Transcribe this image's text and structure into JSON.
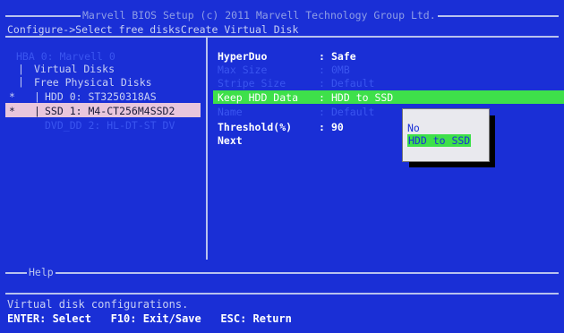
{
  "header": {
    "title": "Marvell BIOS Setup (c) 2011 Marvell Technology Group Ltd.",
    "breadcrumb": "Configure->Select free disksCreate Virtual Disk"
  },
  "tree": {
    "root": "HBA 0: Marvell 0",
    "virtual_disks": "Virtual Disks",
    "free_physical_disks": "Free Physical Disks",
    "disks": [
      {
        "marker": "*",
        "label": "HDD 0: ST3250318AS"
      },
      {
        "marker": "*",
        "label": "SSD 1: M4-CT256M4SSD2"
      },
      {
        "marker": "",
        "label": "DVD_DD 2: HL-DT-ST DV"
      }
    ]
  },
  "settings": [
    {
      "label": "HyperDuo",
      "sep": ":",
      "value": "Safe"
    },
    {
      "label": "Max Size",
      "sep": ":",
      "value": "0MB"
    },
    {
      "label": "Stripe Size",
      "sep": ":",
      "value": "Default"
    },
    {
      "label": "Keep HDD Data",
      "sep": ":",
      "value": "HDD to SSD"
    },
    {
      "label": "Name",
      "sep": ":",
      "value": "Default"
    },
    {
      "label": "Threshold(%)",
      "sep": ":",
      "value": "90"
    }
  ],
  "next_label": "Next",
  "popup": {
    "options": [
      "No",
      "HDD to SSD"
    ],
    "selected": "HDD to SSD"
  },
  "help": {
    "title": "Help",
    "text": "Virtual disk configurations.",
    "keys": "ENTER: Select   F10: Exit/Save   ESC: Return"
  },
  "colors": {
    "background": "#1a2fd6",
    "highlight_green": "#3ee04a",
    "selection_pink": "#e8c6dc"
  }
}
